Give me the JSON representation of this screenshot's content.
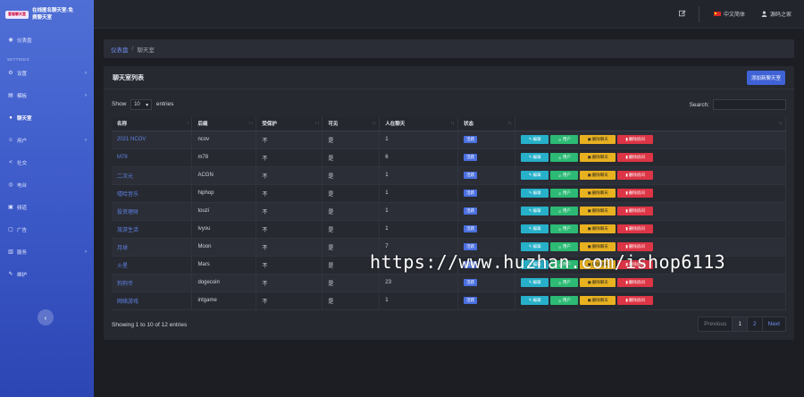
{
  "brand": {
    "logo_text": "客服聊天室",
    "title_line1": "在线匿名聊天室-免",
    "title_line2": "费聊天室"
  },
  "sidebar": {
    "items": [
      {
        "label": "仪表盘",
        "icon": "dashboard-icon",
        "glyph": "◉",
        "chevron": false
      },
      {
        "section": "SETTINGS"
      },
      {
        "label": "设置",
        "icon": "gear-icon",
        "glyph": "⚙",
        "chevron": true
      },
      {
        "label": "模板",
        "icon": "template-icon",
        "glyph": "▤",
        "chevron": true
      },
      {
        "label": "聊天室",
        "icon": "chat-icon",
        "glyph": "●",
        "chevron": false,
        "active": true
      },
      {
        "label": "用户",
        "icon": "user-icon",
        "glyph": "☺",
        "chevron": true
      },
      {
        "label": "社交",
        "icon": "share-icon",
        "glyph": "<",
        "chevron": false
      },
      {
        "label": "电台",
        "icon": "radio-icon",
        "glyph": "◎",
        "chevron": false
      },
      {
        "label": "频道",
        "icon": "channel-icon",
        "glyph": "▣",
        "chevron": false
      },
      {
        "label": "广告",
        "icon": "ad-icon",
        "glyph": "▢",
        "chevron": false
      },
      {
        "label": "服务",
        "icon": "service-icon",
        "glyph": "▥",
        "chevron": true
      },
      {
        "label": "维护",
        "icon": "wrench-icon",
        "glyph": "✎",
        "chevron": false
      }
    ],
    "collapse_glyph": "‹"
  },
  "topbar": {
    "language": "中文简体",
    "username": "源码之家"
  },
  "breadcrumb": {
    "home": "仪表盘",
    "separator": "/",
    "current": "聊天室"
  },
  "card": {
    "title": "聊天室列表",
    "add_button": "添加新聊天室"
  },
  "controls": {
    "show_label": "Show",
    "page_length": "10",
    "entries_label": "entries",
    "search_label": "Search:",
    "search_value": ""
  },
  "table": {
    "columns": [
      "名称",
      "后缀",
      "受保护",
      "可见",
      "人在聊天",
      "状态",
      ""
    ],
    "sort_glyph": "↑↓",
    "first_sort_glyph": "↑",
    "rows": [
      {
        "name": "2021 NCOV",
        "slug": "ncov",
        "protected": "不",
        "visible": "是",
        "online": "1",
        "status": "活跃"
      },
      {
        "name": "M78",
        "slug": "m78",
        "protected": "不",
        "visible": "是",
        "online": "6",
        "status": "活跃"
      },
      {
        "name": "二次元",
        "slug": "ACGN",
        "protected": "不",
        "visible": "是",
        "online": "1",
        "status": "活跃"
      },
      {
        "name": "嘻哈音乐",
        "slug": "hiphop",
        "protected": "不",
        "visible": "是",
        "online": "1",
        "status": "活跃"
      },
      {
        "name": "投资理财",
        "slug": "touzi",
        "protected": "不",
        "visible": "是",
        "online": "1",
        "status": "活跃"
      },
      {
        "name": "旅游生活",
        "slug": "lvyou",
        "protected": "不",
        "visible": "是",
        "online": "1",
        "status": "活跃"
      },
      {
        "name": "月球",
        "slug": "Moon",
        "protected": "不",
        "visible": "是",
        "online": "7",
        "status": "活跃"
      },
      {
        "name": "火星",
        "slug": "Mars",
        "protected": "不",
        "visible": "是",
        "online": "",
        "status": "活跃"
      },
      {
        "name": "狗狗币",
        "slug": "dogecoin",
        "protected": "不",
        "visible": "是",
        "online": "23",
        "status": "活跃"
      },
      {
        "name": "网络游戏",
        "slug": "intgame",
        "protected": "不",
        "visible": "是",
        "online": "1",
        "status": "活跃"
      }
    ],
    "actions": {
      "edit": "编辑",
      "users": "用户",
      "clear": "删除聊天",
      "delete": "删除房间"
    },
    "action_icons": {
      "edit": "✎",
      "users": "☺",
      "clear": "▣",
      "delete": "▮"
    }
  },
  "footer": {
    "info": "Showing 1 to 10 of 12 entries",
    "pagination": {
      "previous": "Previous",
      "pages": [
        "1",
        "2"
      ],
      "current": "1",
      "next": "Next"
    }
  },
  "watermark": "https://www.huzhan.com/ishop6113",
  "colors": {
    "sidebar_top": "#4f6fd6",
    "sidebar_bottom": "#2c46b3",
    "accent": "#3f63d6",
    "link": "#5f82e6",
    "edit": "#27b0c9",
    "users": "#2cba74",
    "clear": "#e8b120",
    "delete": "#dc3545"
  }
}
